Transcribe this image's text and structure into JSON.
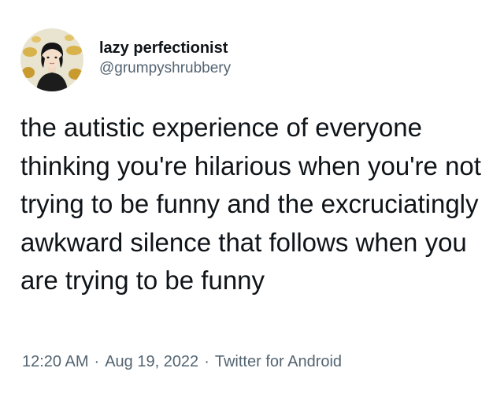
{
  "tweet": {
    "display_name": "lazy perfectionist",
    "handle": "@grumpyshrubbery",
    "text": "the autistic experience of everyone thinking you're hilarious when you're not trying to be funny and the excruciatingly awkward silence that follows when you are trying to be funny",
    "time": "12:20 AM",
    "date": "Aug 19, 2022",
    "source": "Twitter for Android",
    "separator": "·"
  },
  "colors": {
    "text": "#0f1419",
    "secondary": "#536471",
    "background": "#ffffff"
  },
  "icons": {
    "avatar": "avatar-illustration"
  }
}
